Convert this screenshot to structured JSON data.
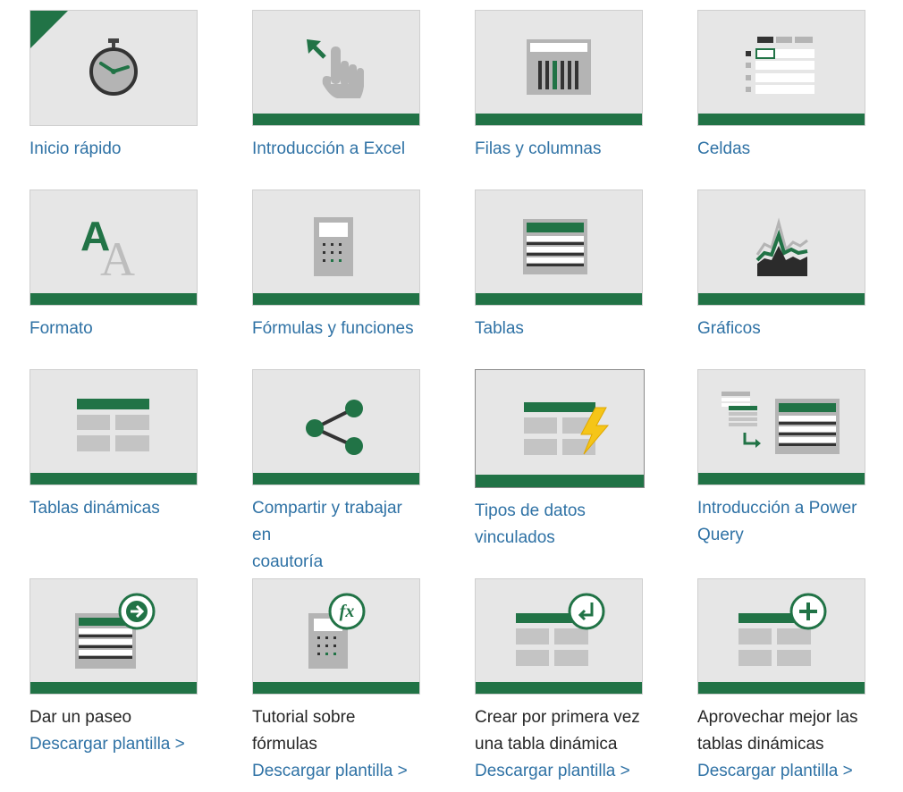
{
  "colors": {
    "accent_green": "#217346",
    "link_blue": "#2f72a5",
    "tile_bg": "#e6e6e6",
    "icon_gray": "#b4b4b4",
    "icon_dark": "#444444"
  },
  "row1": {
    "quick_start": {
      "label": "Inicio rápido",
      "icon": "stopwatch-icon"
    },
    "intro_excel": {
      "label": "Introducción a Excel",
      "icon": "touch-hand-icon"
    },
    "rows_columns": {
      "label": "Filas y columnas",
      "icon": "columns-icon"
    },
    "cells": {
      "label": "Celdas",
      "icon": "cells-icon"
    }
  },
  "row2": {
    "format": {
      "label": "Formato",
      "icon": "font-format-icon",
      "glyph_big": "A",
      "glyph_small": "A"
    },
    "formulas": {
      "label": "Fórmulas y funciones",
      "icon": "calculator-icon"
    },
    "tables": {
      "label": "Tablas",
      "icon": "table-icon"
    },
    "charts": {
      "label": "Gráficos",
      "icon": "chart-icon"
    }
  },
  "row3": {
    "pivot": {
      "label": "Tablas dinámicas",
      "icon": "pivot-table-icon"
    },
    "share": {
      "label_line1": "Compartir y trabajar en",
      "label_line2": "coautoría",
      "icon": "share-icon"
    },
    "linked_types": {
      "label_line1": "Tipos de datos",
      "label_line2": "vinculados",
      "icon": "lightning-table-icon"
    },
    "power_query": {
      "label_line1": "Introducción a Power",
      "label_line2": "Query",
      "icon": "power-query-icon"
    }
  },
  "row4": {
    "tour": {
      "title": "Dar un paseo",
      "link": "Descargar plantilla >",
      "icon": "tour-arrow-icon"
    },
    "formula_tutorial": {
      "title": "Tutorial sobre fórmulas",
      "link": "Descargar plantilla >",
      "icon": "fx-calculator-icon",
      "badge": "fx"
    },
    "first_pivot": {
      "title_line1": "Crear por primera vez",
      "title_line2": "una tabla dinámica",
      "link": "Descargar plantilla >",
      "icon": "pivot-return-icon"
    },
    "better_pivots": {
      "title_line1": "Aprovechar mejor las",
      "title_line2": "tablas dinámicas",
      "link": "Descargar plantilla >",
      "icon": "pivot-plus-icon"
    }
  }
}
